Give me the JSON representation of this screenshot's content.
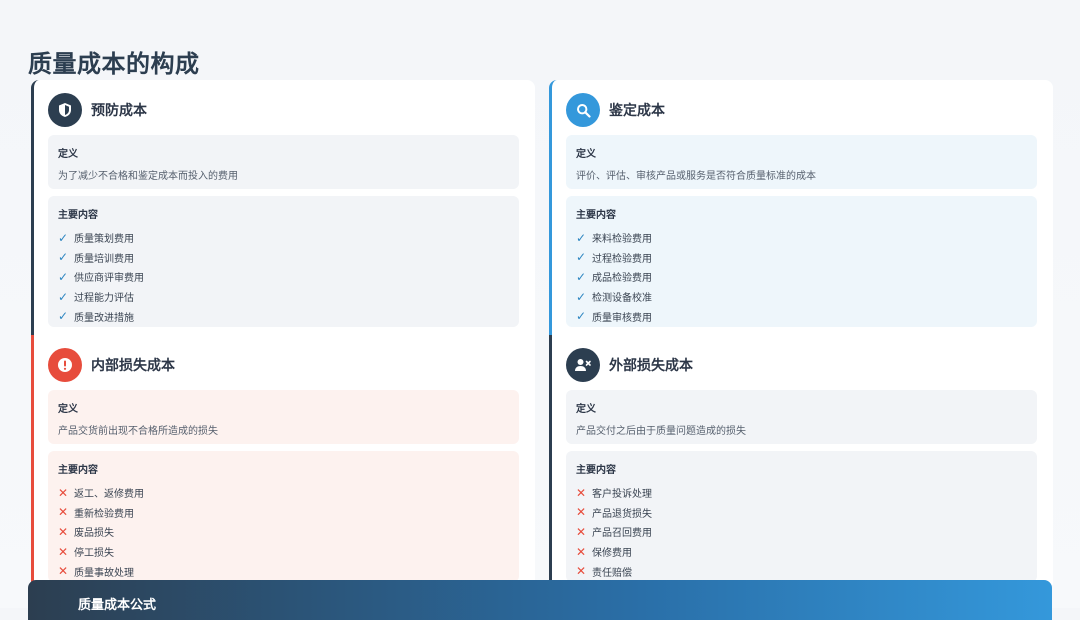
{
  "page": {
    "title": "质量成本的构成"
  },
  "cards": [
    {
      "title": "预防成本",
      "icon": "shield-icon",
      "definition_label": "定义",
      "definition": "为了减少不合格和鉴定成本而投入的费用",
      "contents_label": "主要内容",
      "mark": "✓",
      "items": [
        "质量策划费用",
        "质量培训费用",
        "供应商评审费用",
        "过程能力评估",
        "质量改进措施"
      ]
    },
    {
      "title": "鉴定成本",
      "icon": "search-icon",
      "definition_label": "定义",
      "definition": "评价、评估、审核产品或服务是否符合质量标准的成本",
      "contents_label": "主要内容",
      "mark": "✓",
      "items": [
        "来料检验费用",
        "过程检验费用",
        "成品检验费用",
        "检测设备校准",
        "质量审核费用"
      ]
    },
    {
      "title": "内部损失成本",
      "icon": "exclamation-icon",
      "definition_label": "定义",
      "definition": "产品交货前出现不合格所造成的损失",
      "contents_label": "主要内容",
      "mark": "✕",
      "items": [
        "返工、返修费用",
        "重新检验费用",
        "废品损失",
        "停工损失",
        "质量事故处理"
      ]
    },
    {
      "title": "外部损失成本",
      "icon": "user-times-icon",
      "definition_label": "定义",
      "definition": "产品交付之后由于质量问题造成的损失",
      "contents_label": "主要内容",
      "mark": "✕",
      "items": [
        "客户投诉处理",
        "产品退货损失",
        "产品召回费用",
        "保修费用",
        "责任赔偿"
      ]
    }
  ],
  "formula": {
    "title": "质量成本公式"
  },
  "colors": {
    "dark": "#2c3e50",
    "blue": "#3498db",
    "red": "#e74c3c",
    "check": "#2e86c1"
  }
}
